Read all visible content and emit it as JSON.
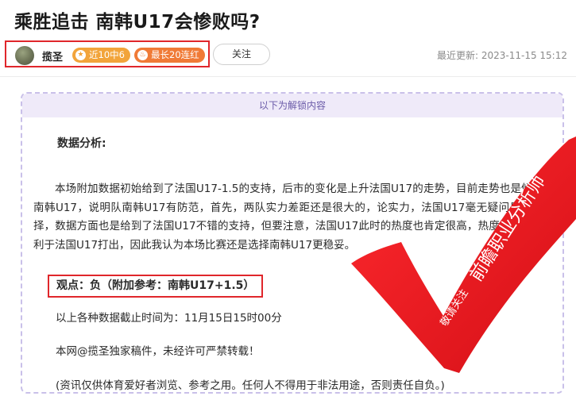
{
  "article": {
    "title": "乘胜追击 南韩U17会惨败吗?",
    "author": "揽圣",
    "badge_recent": "近10中6",
    "badge_streak": "最长20连红",
    "follow_label": "关注",
    "update_label": "最近更新:",
    "update_time": "2023-11-15 15:12"
  },
  "locked": {
    "header": "以下为解锁内容",
    "section_title": "数据分析:",
    "paragraph": "本场附加数据初始给到了法国U17-1.5的支持，后市的变化是上升法国U17的走势，目前走势也是倾向于南韩U17，说明队南韩U17有防范，首先，两队实力差距还是很大的，论实力，法国U17毫无疑问是第一选择，数据方面也是给到了法国U17不错的支持，但要注意，法国U17此时的热度也肯定很高，热度太高反而不利于法国U17打出，因此我认为本场比赛还是选择南韩U17更稳妥。",
    "viewpoint": "观点：负（附加参考：南韩U17+1.5）",
    "data_time": "以上各种数据截止时间为：11月15日15时00分",
    "copyright": "本网@揽圣独家稿件，未经许可严禁转载！",
    "disclaimer": "(资讯仅供体育爱好者浏览、参考之用。任何人不得用于非法用途，否则责任自负。)"
  },
  "stamp": {
    "main_text": "前瞻职业分析师",
    "sub_text": "敬请关注",
    "color": "#e8141c"
  }
}
